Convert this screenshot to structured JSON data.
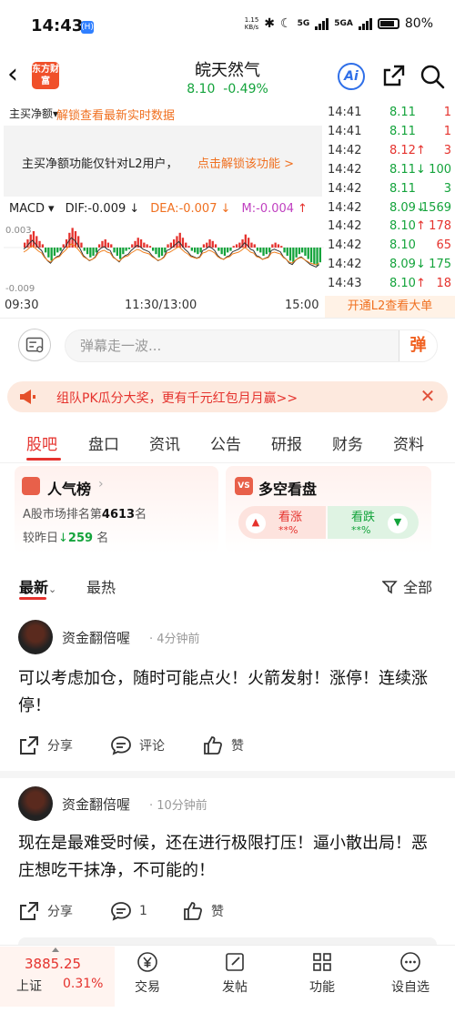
{
  "status": {
    "time": "14:43",
    "app_icon": "(H)",
    "net_speed_value": "1.15",
    "net_speed_unit": "KB/s",
    "net_5g": "5G",
    "net_5ga": "5GA",
    "battery": "80%"
  },
  "header": {
    "brand_logo": "东方财富",
    "stock_name": "皖天然气",
    "price": "8.10",
    "change_pct": "-0.49%",
    "ai_label": "Ai"
  },
  "l2": {
    "label": "主买净额",
    "dropdown_arrow": "▾",
    "unlock_link": "解锁查看最新实时数据",
    "banner_text": "主买净额功能仅针对L2用户，",
    "banner_link": "点击解锁该功能 >",
    "big_order_button": "开通L2查看大单"
  },
  "macd": {
    "label": "MACD",
    "dropdown_arrow": "▾",
    "dif": "DIF:-0.009",
    "dif_arrow": "↓",
    "dea": "DEA:-0.007",
    "dea_arrow": "↓",
    "m": "M:-0.004",
    "m_arrow": "↑",
    "ymax_label": "0.003",
    "ymin_label": "-0.009",
    "bars": [
      0.3,
      0.5,
      0.8,
      1.0,
      0.7,
      0.4,
      0.2,
      -0.3,
      -0.6,
      -0.8,
      -0.5,
      -0.3,
      -0.2,
      0.2,
      0.5,
      0.9,
      1.2,
      1.0,
      0.7,
      0.3,
      -0.2,
      -0.4,
      -0.6,
      -0.5,
      -0.3,
      0.2,
      0.4,
      0.5,
      0.3,
      0.2,
      -0.3,
      -0.5,
      -0.7,
      -0.4,
      -0.2,
      -0.1,
      0.2,
      0.4,
      0.6,
      0.5,
      0.3,
      0.2,
      0.1,
      -0.2,
      -0.4,
      -0.6,
      -0.5,
      -0.3,
      0.2,
      0.3,
      0.5,
      0.7,
      0.9,
      0.6,
      0.3,
      0.1,
      -0.2,
      -0.3,
      -0.4,
      -0.3,
      0.2,
      0.3,
      0.5,
      0.4,
      0.2,
      -0.2,
      -0.4,
      -0.5,
      -0.3,
      -0.2,
      0.1,
      0.2,
      0.3,
      0.5,
      0.8,
      0.6,
      0.3,
      0.2,
      -0.2,
      -0.3,
      -0.5,
      -0.4,
      -0.3,
      0.2,
      0.3,
      0.2,
      0.1,
      -0.3,
      -0.5,
      -0.8,
      -0.9,
      -0.6,
      -0.4,
      -0.3,
      -0.5,
      -0.7,
      -0.9,
      -1.0,
      -1.1,
      -0.9
    ]
  },
  "xaxis": {
    "start": "09:30",
    "mid": "11:30/13:00",
    "end": "15:00"
  },
  "ticks": [
    {
      "time": "14:41",
      "price": "8.11",
      "arrow": "",
      "vol": "1",
      "color": "#13a33b",
      "vol_color": "#e5322d"
    },
    {
      "time": "14:41",
      "price": "8.11",
      "arrow": "",
      "vol": "1",
      "color": "#13a33b",
      "vol_color": "#e5322d"
    },
    {
      "time": "14:42",
      "price": "8.12",
      "arrow": "↑",
      "vol": "3",
      "color": "#e5322d",
      "vol_color": "#e5322d"
    },
    {
      "time": "14:42",
      "price": "8.11",
      "arrow": "↓",
      "vol": "100",
      "color": "#13a33b",
      "vol_color": "#13a33b"
    },
    {
      "time": "14:42",
      "price": "8.11",
      "arrow": "",
      "vol": "3",
      "color": "#13a33b",
      "vol_color": "#13a33b"
    },
    {
      "time": "14:42",
      "price": "8.09",
      "arrow": "↓",
      "vol": "1569",
      "color": "#13a33b",
      "vol_color": "#13a33b"
    },
    {
      "time": "14:42",
      "price": "8.10",
      "arrow": "↑",
      "vol": "178",
      "color": "#13a33b",
      "vol_color": "#e5322d"
    },
    {
      "time": "14:42",
      "price": "8.10",
      "arrow": "",
      "vol": "65",
      "color": "#13a33b",
      "vol_color": "#e5322d"
    },
    {
      "time": "14:42",
      "price": "8.09",
      "arrow": "↓",
      "vol": "175",
      "color": "#13a33b",
      "vol_color": "#13a33b"
    },
    {
      "time": "14:43",
      "price": "8.10",
      "arrow": "↑",
      "vol": "18",
      "color": "#13a33b",
      "vol_color": "#e5322d"
    }
  ],
  "danmaku": {
    "placeholder": "弹幕走一波...",
    "send_label": "弹"
  },
  "promo": {
    "text": "组队PK瓜分大奖，更有千元红包月月赢>>",
    "close": "✕"
  },
  "tabs": [
    "股吧",
    "盘口",
    "资讯",
    "公告",
    "研报",
    "财务",
    "资料"
  ],
  "popularity": {
    "title": "人气榜",
    "chevron": "›",
    "rank_prefix": "A股市场排名第",
    "rank_value": "4613",
    "rank_suffix": "名",
    "change_prefix": "较昨日",
    "change_arrow": "↓",
    "change_value": "259",
    "change_suffix": "名"
  },
  "bullbear": {
    "icon": "VS",
    "title": "多空看盘",
    "bull_label": "看涨",
    "bull_pct": "**%",
    "bear_label": "看跌",
    "bear_pct": "**%"
  },
  "sort": {
    "latest": "最新",
    "latest_arrow": "⌄",
    "hot": "最热",
    "filter": "全部"
  },
  "posts": [
    {
      "user": "资金翻倍喔",
      "time": "4分钟前",
      "body": "可以考虑加仓，随时可能点火！火箭发射！涨停！连续涨停！",
      "share": "分享",
      "comment": "评论",
      "like": "赞"
    },
    {
      "user": "资金翻倍喔",
      "time": "10分钟前",
      "body": "现在是最难受时候，还在进行极限打压！逼小散出局！恶庄想吃干抹净，不可能的！",
      "share": "分享",
      "comment": "1",
      "like": "赞"
    }
  ],
  "bottom_nav": {
    "index_value": "3885.25",
    "index_name": "上证",
    "index_pct": "0.31%",
    "items": [
      "交易",
      "发帖",
      "功能",
      "设自选"
    ]
  },
  "colors": {
    "red": "#e5322d",
    "green": "#13a33b",
    "orange": "#f07020",
    "accent_blue": "#2f6fe8"
  }
}
